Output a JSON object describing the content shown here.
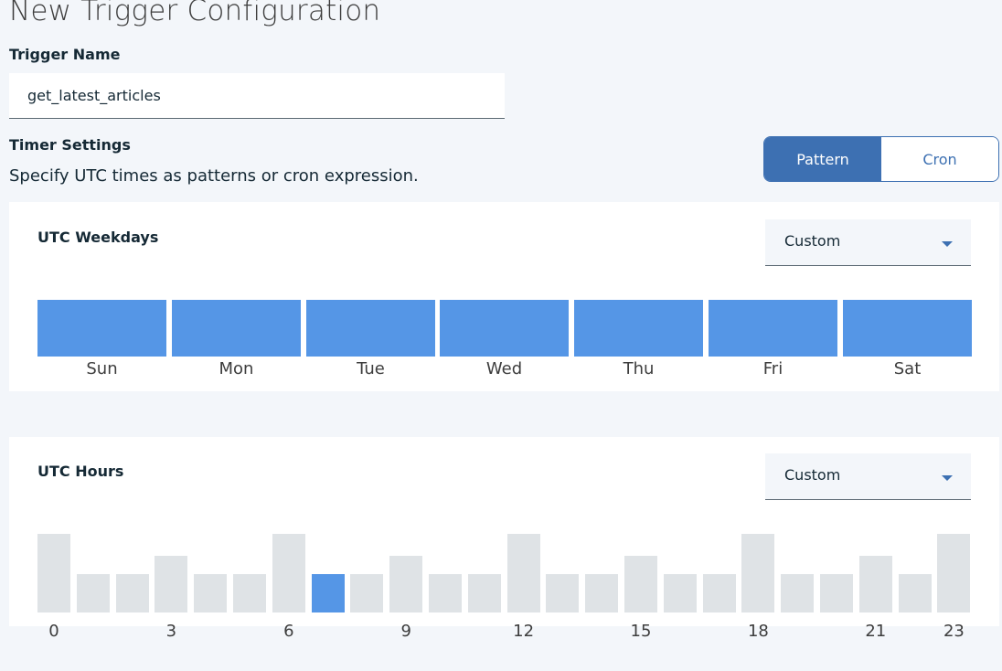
{
  "title": "New Trigger Configuration",
  "trigger_name": {
    "label": "Trigger Name",
    "value": "get_latest_articles"
  },
  "timer": {
    "label": "Timer Settings",
    "description": "Specify UTC times as patterns or cron expression.",
    "modes": [
      "Pattern",
      "Cron"
    ],
    "active_mode": "Pattern"
  },
  "weekdays": {
    "title": "UTC Weekdays",
    "dropdown": "Custom",
    "days": [
      "Sun",
      "Mon",
      "Tue",
      "Wed",
      "Thu",
      "Fri",
      "Sat"
    ],
    "selected": [
      true,
      true,
      true,
      true,
      true,
      true,
      true
    ]
  },
  "hours": {
    "title": "UTC Hours",
    "dropdown": "Custom",
    "labels": [
      "0",
      "3",
      "6",
      "9",
      "12",
      "15",
      "18",
      "21",
      "23"
    ],
    "selected_hours": [
      7
    ]
  },
  "colors": {
    "accent": "#3d70b2",
    "selected": "#5596e6",
    "unselected": "#dfe3e6",
    "background": "#f3f6fa"
  }
}
